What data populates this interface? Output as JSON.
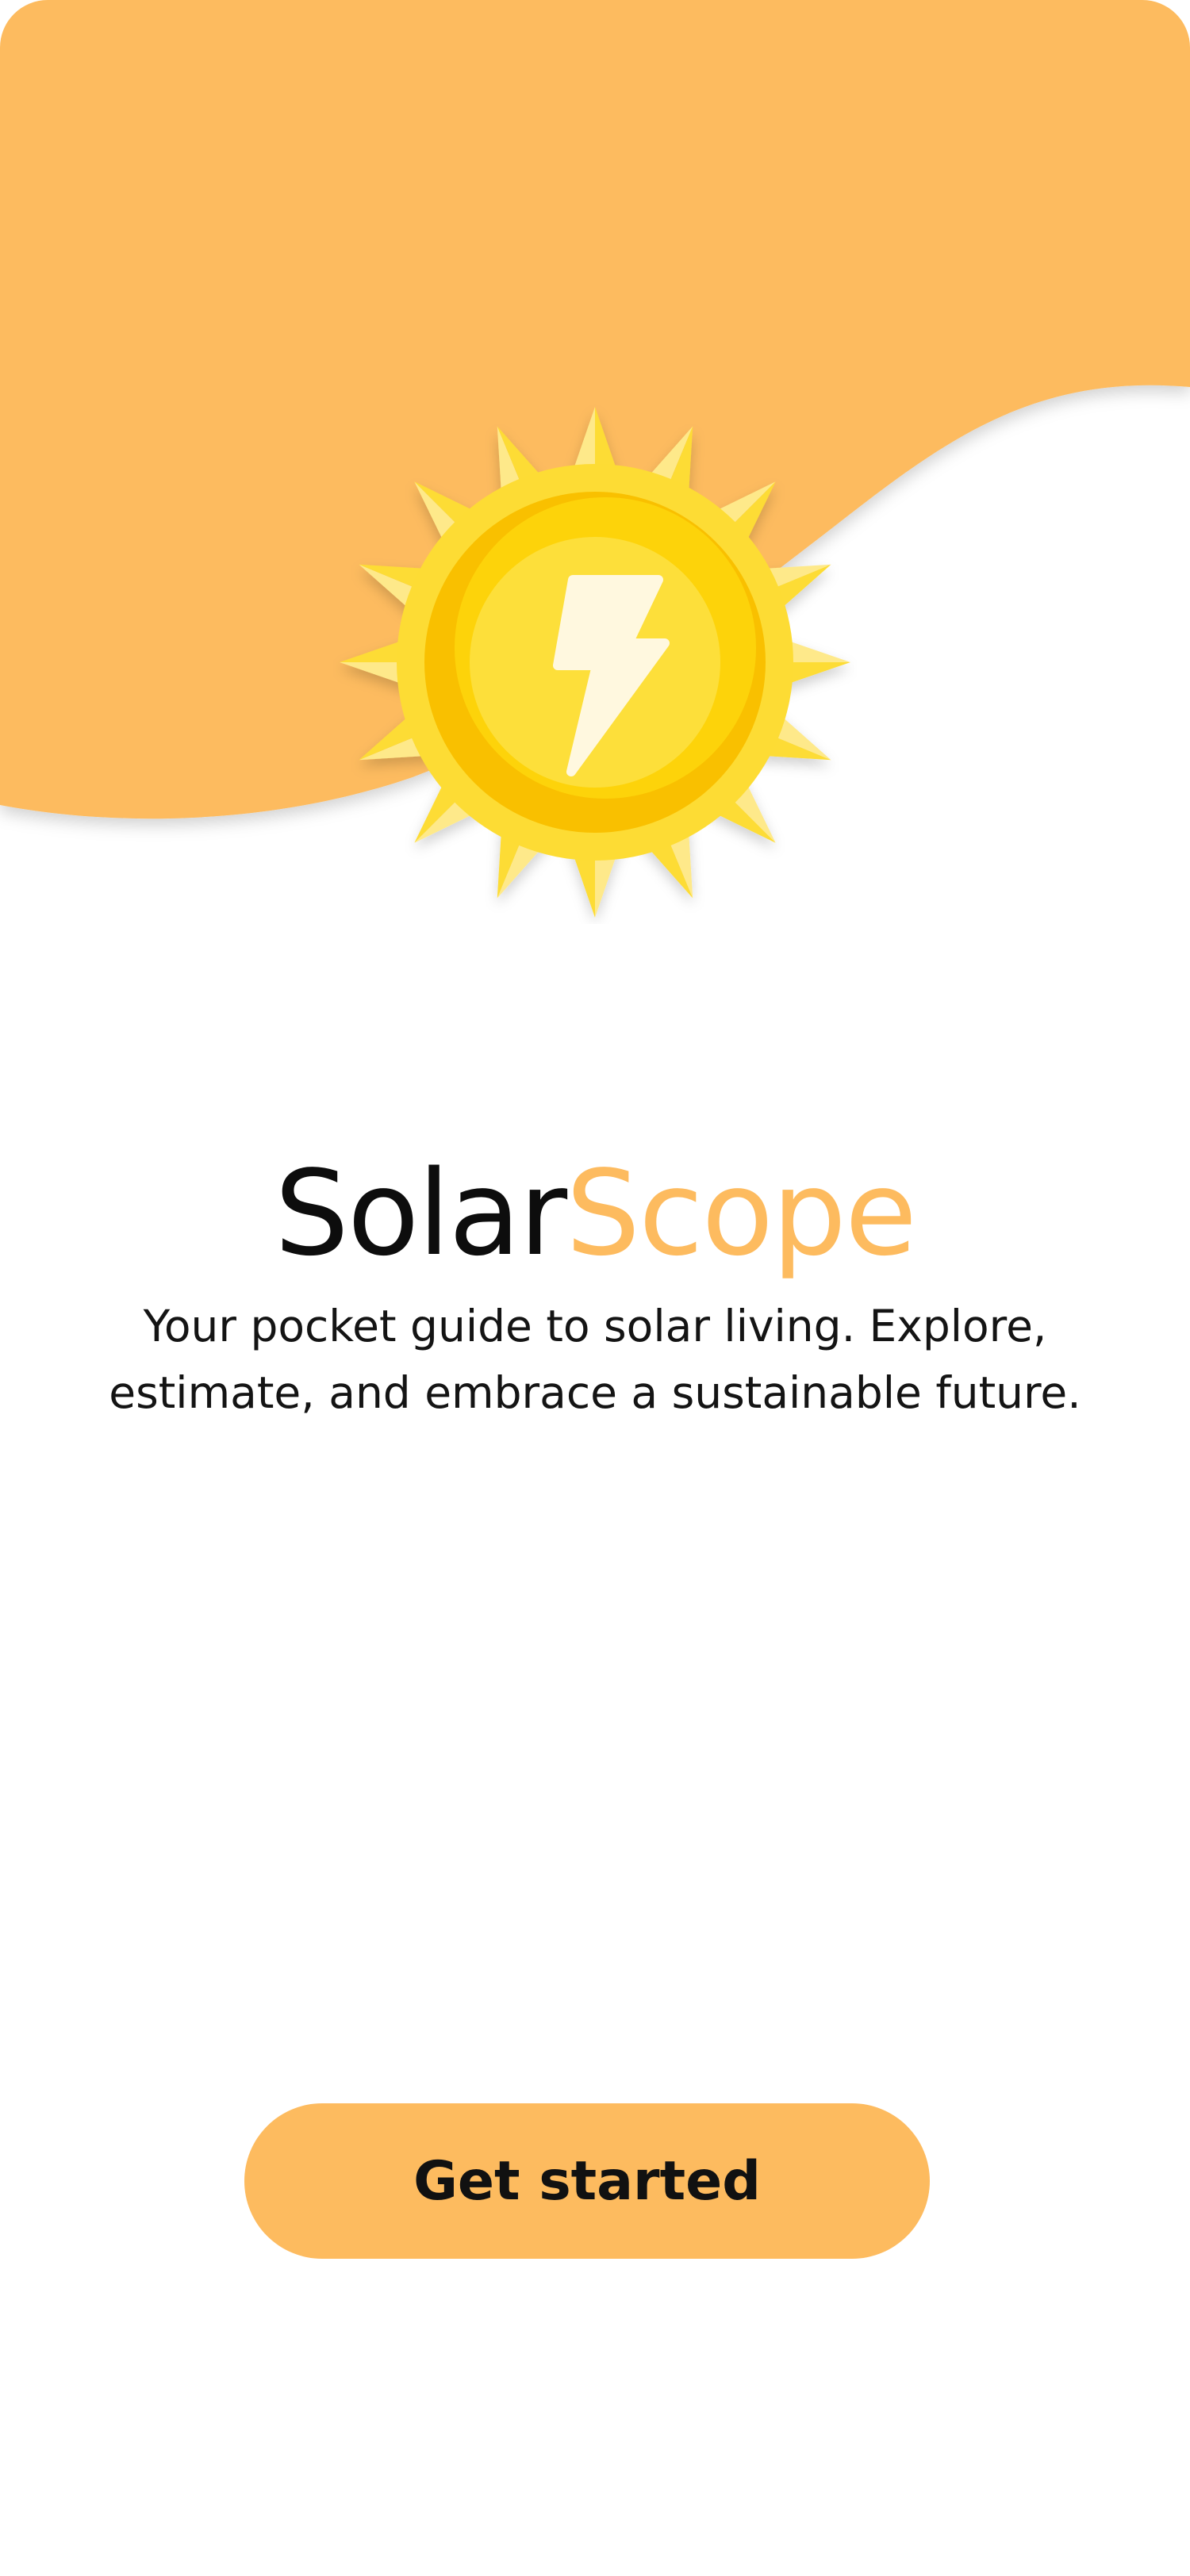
{
  "app": {
    "name_part1": "Solar",
    "name_part2": "Scope"
  },
  "tagline": {
    "line1": "Your pocket guide to solar living. Explore,",
    "line2": "estimate, and embrace a sustainable future."
  },
  "cta": {
    "label": "Get started"
  },
  "icons": {
    "hero": "sun-lightning-icon"
  },
  "colors": {
    "accent": "#FDBB5F",
    "sun_primary": "#FDDC34",
    "sun_dark": "#F9C000",
    "bolt": "#FFF8DF",
    "background": "#FFFFFF",
    "text": "#111111"
  }
}
